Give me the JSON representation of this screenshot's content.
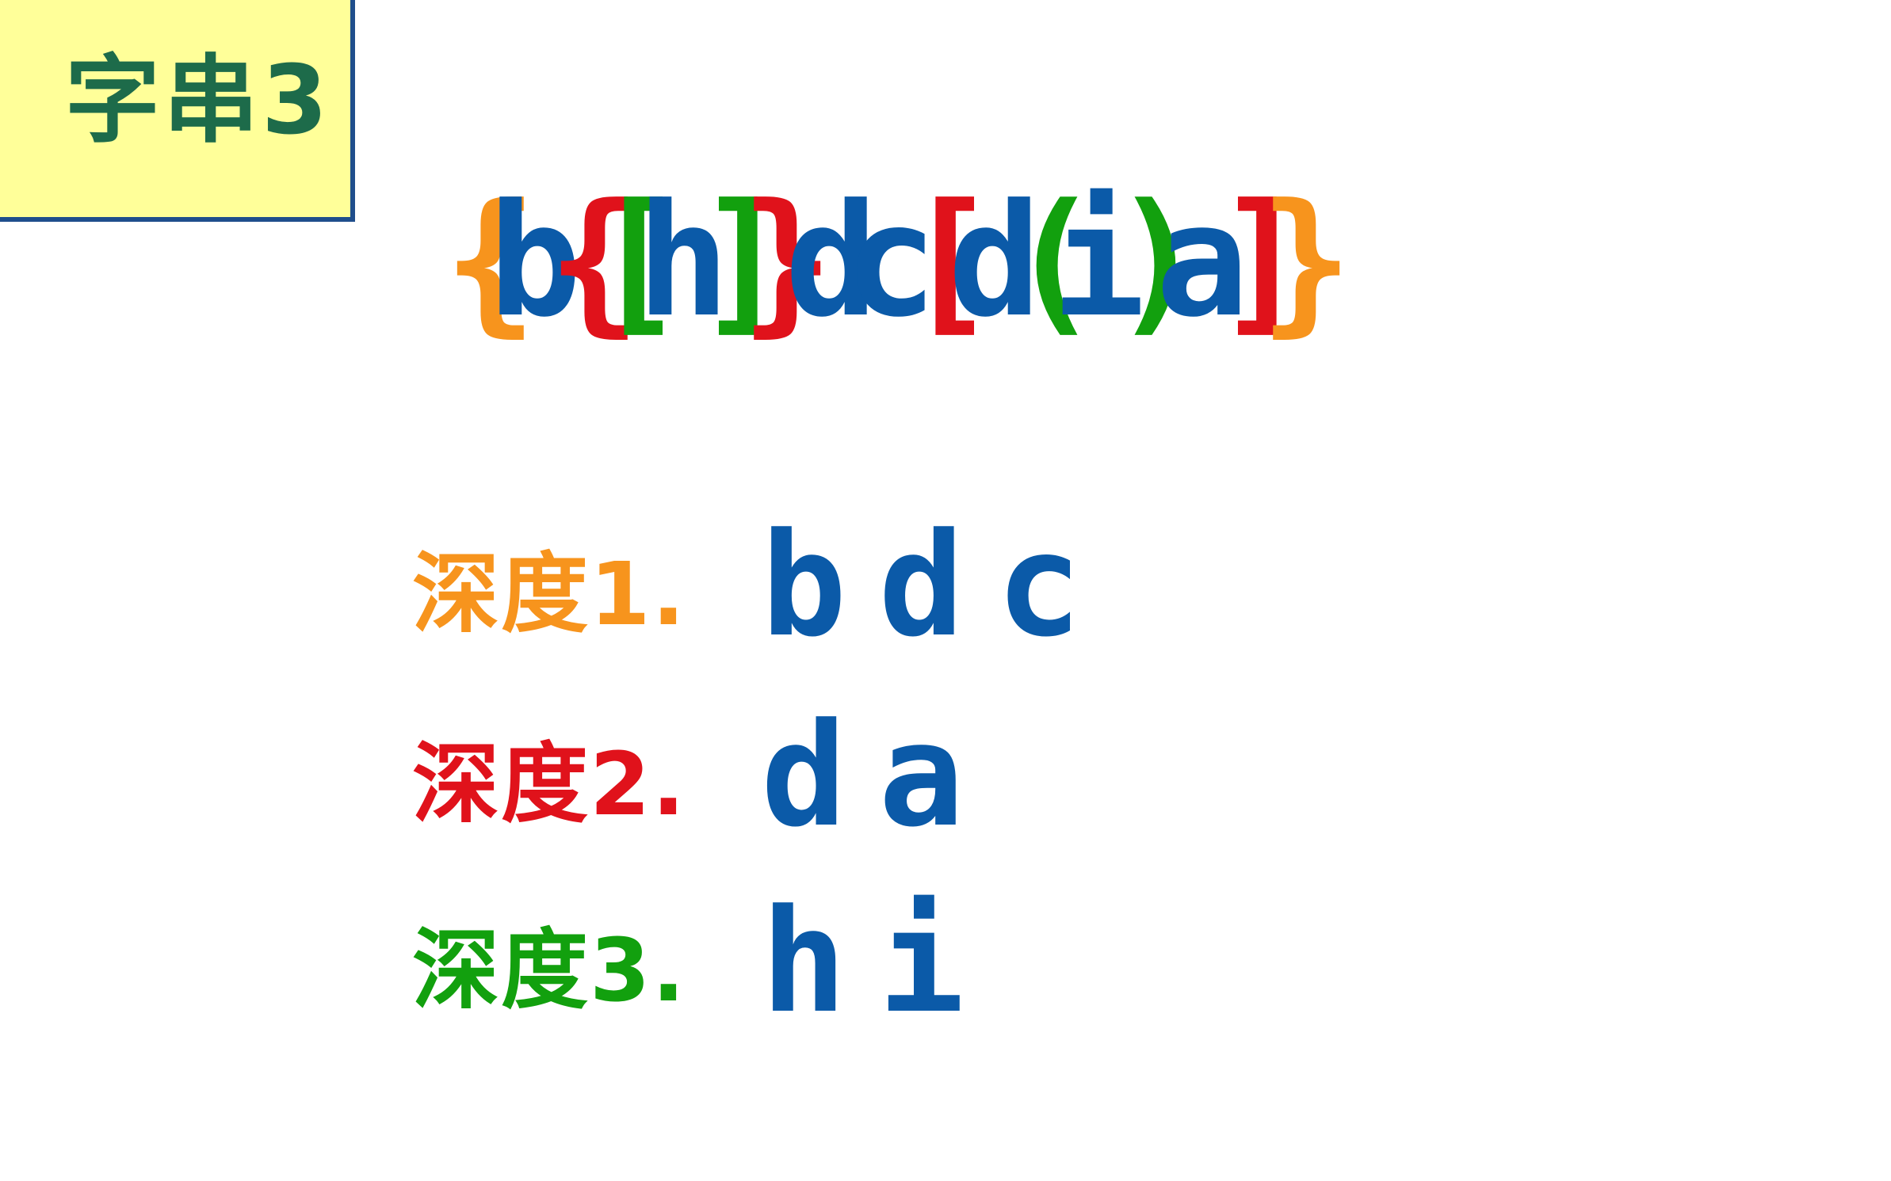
{
  "title": {
    "text": "字串3",
    "background": "#ffff99",
    "border_color": "#1f4e8c",
    "text_color": "#1d6b4a"
  },
  "expression": {
    "chars": [
      {
        "c": "{",
        "color": "#f7941d",
        "kind": "brace"
      },
      {
        "c": "b",
        "color": "#0b5aa8",
        "kind": "letter"
      },
      {
        "c": "{",
        "color": "#e0121b",
        "kind": "brace"
      },
      {
        "c": "[",
        "color": "#12a00e",
        "kind": "bracket"
      },
      {
        "c": "h",
        "color": "#0b5aa8",
        "kind": "letter"
      },
      {
        "c": "]",
        "color": "#12a00e",
        "kind": "bracket"
      },
      {
        "c": "}",
        "color": "#e0121b",
        "kind": "brace"
      },
      {
        "c": "d",
        "color": "#0b5aa8",
        "kind": "letter"
      },
      {
        "c": "c",
        "color": "#0b5aa8",
        "kind": "letter"
      },
      {
        "c": "[",
        "color": "#e0121b",
        "kind": "bracket"
      },
      {
        "c": "d",
        "color": "#0b5aa8",
        "kind": "letter"
      },
      {
        "c": "(",
        "color": "#12a00e",
        "kind": "paren"
      },
      {
        "c": "i",
        "color": "#0b5aa8",
        "kind": "letter"
      },
      {
        "c": ")",
        "color": "#12a00e",
        "kind": "paren"
      },
      {
        "c": "a",
        "color": "#0b5aa8",
        "kind": "letter"
      },
      {
        "c": "]",
        "color": "#e0121b",
        "kind": "bracket"
      },
      {
        "c": "}",
        "color": "#f7941d",
        "kind": "brace"
      }
    ]
  },
  "depths": [
    {
      "label": "深度1.",
      "value": "bdc",
      "label_color": "#f7941d"
    },
    {
      "label": "深度2.",
      "value": "da",
      "label_color": "#e0121b"
    },
    {
      "label": "深度3.",
      "value": "hi",
      "label_color": "#12a00e"
    }
  ],
  "colors": {
    "value_blue": "#0b5aa8",
    "orange": "#f7941d",
    "red": "#e0121b",
    "green": "#12a00e"
  }
}
